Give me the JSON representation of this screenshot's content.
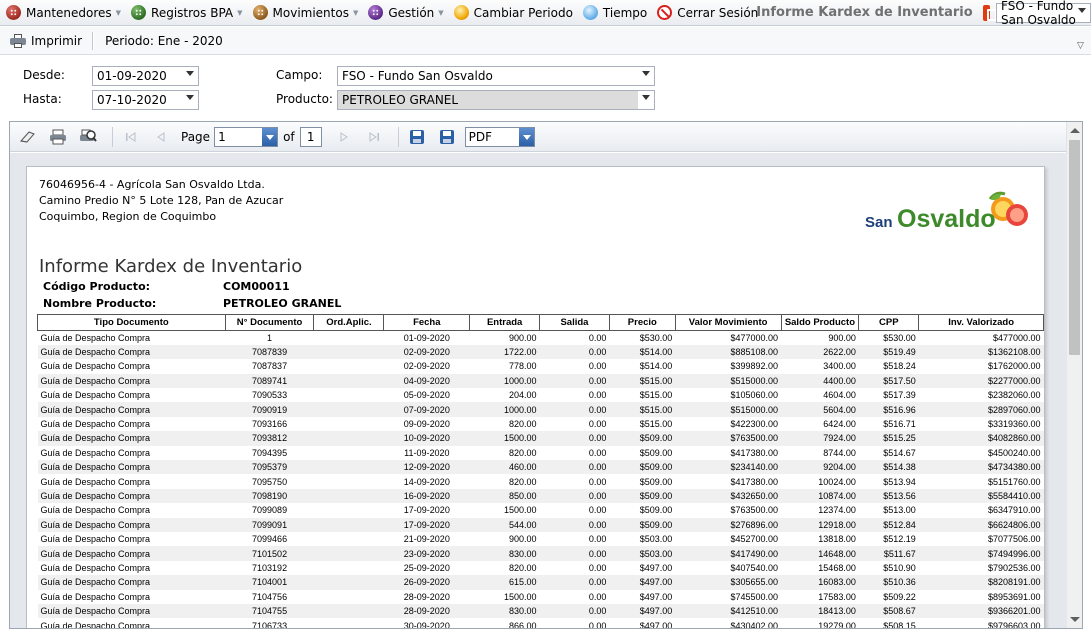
{
  "menubar": {
    "items": [
      {
        "label": "Mantenedores",
        "has_dropdown": true,
        "icon": "grid-icon"
      },
      {
        "label": "Registros BPA",
        "has_dropdown": true,
        "icon": "grid-icon"
      },
      {
        "label": "Movimientos",
        "has_dropdown": true,
        "icon": "grid-icon"
      },
      {
        "label": "Gestión",
        "has_dropdown": true,
        "icon": "grid-icon"
      },
      {
        "label": "Cambiar Periodo",
        "icon": "clock-icon"
      },
      {
        "label": "Tiempo",
        "icon": "weather-icon"
      },
      {
        "label": "Cerrar Sesión",
        "icon": "logout-icon"
      }
    ],
    "app_title": "Informe Kardex de Inventario",
    "fundo_selected": "FSO - Fundo San Osvaldo"
  },
  "toolbar": {
    "print_label": "Imprimir",
    "periodo": "Periodo: Ene - 2020"
  },
  "filters": {
    "desde_label": "Desde:",
    "desde_value": "01-09-2020",
    "hasta_label": "Hasta:",
    "hasta_value": "07-10-2020",
    "campo_label": "Campo:",
    "campo_value": "FSO - Fundo San Osvaldo",
    "producto_label": "Producto:",
    "producto_value": "PETROLEO GRANEL"
  },
  "viewer": {
    "page_label": "Page",
    "page_value": "1",
    "of_label": "of",
    "total_pages": "1",
    "export_format": "PDF"
  },
  "report": {
    "company_lines": [
      "76046956-4 - Agrícola San Osvaldo Ltda.",
      "Camino Predio N° 5 Lote 128, Pan de Azucar",
      "Coquimbo, Region de Coquimbo"
    ],
    "logo_text": {
      "san": "San",
      "osvaldo": "Osvaldo"
    },
    "title": "Informe Kardex de Inventario",
    "codigo_label": "Código Producto:",
    "codigo_value": "COM00011",
    "nombre_label": "Nombre Producto:",
    "nombre_value": "PETROLEO GRANEL",
    "columns": [
      "Tipo Documento",
      "N° Documento",
      "Ord.Aplic.",
      "Fecha",
      "Entrada",
      "Salida",
      "Precio",
      "Valor Movimiento",
      "Saldo Producto",
      "CPP",
      "Inv. Valorizado"
    ],
    "rows": [
      [
        "Guía de Despacho Compra",
        "1",
        "",
        "01-09-2020",
        "900.00",
        "0.00",
        "$530.00",
        "$477000.00",
        "900.00",
        "$530.00",
        "$477000.00"
      ],
      [
        "Guía de Despacho Compra",
        "7087839",
        "",
        "02-09-2020",
        "1722.00",
        "0.00",
        "$514.00",
        "$885108.00",
        "2622.00",
        "$519.49",
        "$1362108.00"
      ],
      [
        "Guía de Despacho Compra",
        "7087837",
        "",
        "02-09-2020",
        "778.00",
        "0.00",
        "$514.00",
        "$399892.00",
        "3400.00",
        "$518.24",
        "$1762000.00"
      ],
      [
        "Guía de Despacho Compra",
        "7089741",
        "",
        "04-09-2020",
        "1000.00",
        "0.00",
        "$515.00",
        "$515000.00",
        "4400.00",
        "$517.50",
        "$2277000.00"
      ],
      [
        "Guía de Despacho Compra",
        "7090533",
        "",
        "05-09-2020",
        "204.00",
        "0.00",
        "$515.00",
        "$105060.00",
        "4604.00",
        "$517.39",
        "$2382060.00"
      ],
      [
        "Guía de Despacho Compra",
        "7090919",
        "",
        "07-09-2020",
        "1000.00",
        "0.00",
        "$515.00",
        "$515000.00",
        "5604.00",
        "$516.96",
        "$2897060.00"
      ],
      [
        "Guía de Despacho Compra",
        "7093166",
        "",
        "09-09-2020",
        "820.00",
        "0.00",
        "$515.00",
        "$422300.00",
        "6424.00",
        "$516.71",
        "$3319360.00"
      ],
      [
        "Guía de Despacho Compra",
        "7093812",
        "",
        "10-09-2020",
        "1500.00",
        "0.00",
        "$509.00",
        "$763500.00",
        "7924.00",
        "$515.25",
        "$4082860.00"
      ],
      [
        "Guía de Despacho Compra",
        "7094395",
        "",
        "11-09-2020",
        "820.00",
        "0.00",
        "$509.00",
        "$417380.00",
        "8744.00",
        "$514.67",
        "$4500240.00"
      ],
      [
        "Guía de Despacho Compra",
        "7095379",
        "",
        "12-09-2020",
        "460.00",
        "0.00",
        "$509.00",
        "$234140.00",
        "9204.00",
        "$514.38",
        "$4734380.00"
      ],
      [
        "Guía de Despacho Compra",
        "7095750",
        "",
        "14-09-2020",
        "820.00",
        "0.00",
        "$509.00",
        "$417380.00",
        "10024.00",
        "$513.94",
        "$5151760.00"
      ],
      [
        "Guía de Despacho Compra",
        "7098190",
        "",
        "16-09-2020",
        "850.00",
        "0.00",
        "$509.00",
        "$432650.00",
        "10874.00",
        "$513.56",
        "$5584410.00"
      ],
      [
        "Guía de Despacho Compra",
        "7099089",
        "",
        "17-09-2020",
        "1500.00",
        "0.00",
        "$509.00",
        "$763500.00",
        "12374.00",
        "$513.00",
        "$6347910.00"
      ],
      [
        "Guía de Despacho Compra",
        "7099091",
        "",
        "17-09-2020",
        "544.00",
        "0.00",
        "$509.00",
        "$276896.00",
        "12918.00",
        "$512.84",
        "$6624806.00"
      ],
      [
        "Guía de Despacho Compra",
        "7099466",
        "",
        "21-09-2020",
        "900.00",
        "0.00",
        "$503.00",
        "$452700.00",
        "13818.00",
        "$512.19",
        "$7077506.00"
      ],
      [
        "Guía de Despacho Compra",
        "7101502",
        "",
        "23-09-2020",
        "830.00",
        "0.00",
        "$503.00",
        "$417490.00",
        "14648.00",
        "$511.67",
        "$7494996.00"
      ],
      [
        "Guía de Despacho Compra",
        "7103192",
        "",
        "25-09-2020",
        "820.00",
        "0.00",
        "$497.00",
        "$407540.00",
        "15468.00",
        "$510.90",
        "$7902536.00"
      ],
      [
        "Guía de Despacho Compra",
        "7104001",
        "",
        "26-09-2020",
        "615.00",
        "0.00",
        "$497.00",
        "$305655.00",
        "16083.00",
        "$510.36",
        "$8208191.00"
      ],
      [
        "Guía de Despacho Compra",
        "7104756",
        "",
        "28-09-2020",
        "1500.00",
        "0.00",
        "$497.00",
        "$745500.00",
        "17583.00",
        "$509.22",
        "$8953691.00"
      ],
      [
        "Guía de Despacho Compra",
        "7104755",
        "",
        "28-09-2020",
        "830.00",
        "0.00",
        "$497.00",
        "$412510.00",
        "18413.00",
        "$508.67",
        "$9366201.00"
      ],
      [
        "Guía de Despacho Compra",
        "7106733",
        "",
        "30-09-2020",
        "866.00",
        "0.00",
        "$497.00",
        "$430402.00",
        "19279.00",
        "$508.15",
        "$9796603.00"
      ]
    ]
  },
  "colors": {
    "logo_green": "#3d8a2a",
    "logo_navy": "#1d3f7a",
    "accent_blue": "#2b5fa6"
  }
}
